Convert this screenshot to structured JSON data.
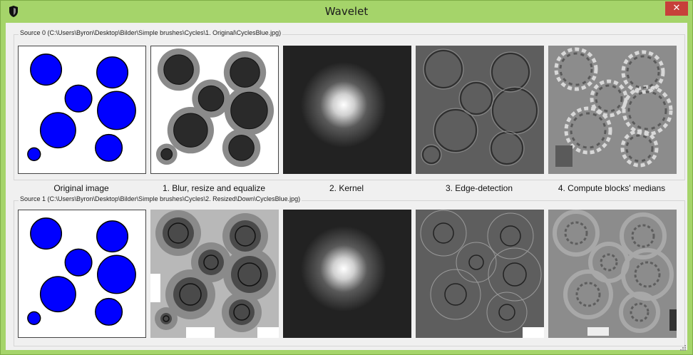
{
  "window": {
    "title": "Wavelet",
    "close_label": "✕"
  },
  "sources": [
    {
      "label": "Source 0 (C:\\Users\\Byron\\Desktop\\Bilder\\Simple brushes\\Cycles\\1. Original\\CyclesBlue.jpg)"
    },
    {
      "label": "Source 1 (C:\\Users\\Byron\\Desktop\\Bilder\\Simple brushes\\Cycles\\2. Resized\\Down\\CyclesBlue.jpg)"
    }
  ],
  "captions": [
    "Original image",
    "1. Blur, resize and equalize",
    "2. Kernel",
    "3. Edge-detection",
    "4. Compute blocks' medians"
  ],
  "colors": {
    "frame": "#a5d46a",
    "close": "#c7403a",
    "circle_fill": "#0000ff"
  },
  "icons": {
    "app": "shield-icon",
    "close": "close-icon",
    "grip": "resize-grip-icon"
  }
}
